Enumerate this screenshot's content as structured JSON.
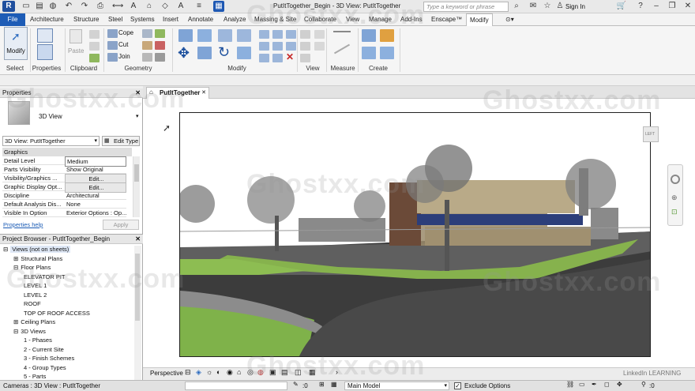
{
  "titlebar": {
    "doc_title": "PutItTogether_Begin - 3D View: PutItTogether",
    "search_placeholder": "Type a keyword or phrase",
    "sign_in": "Sign In"
  },
  "tabs": [
    "File",
    "Architecture",
    "Structure",
    "Steel",
    "Systems",
    "Insert",
    "Annotate",
    "Analyze",
    "Massing & Site",
    "Collaborate",
    "View",
    "Manage",
    "Add-Ins",
    "Enscape™",
    "Modify"
  ],
  "active_tab": "Modify",
  "ribbon": {
    "select": {
      "modify_label": "Modify",
      "group": "Select"
    },
    "properties_group": "Properties",
    "clipboard": {
      "paste": "Paste",
      "group": "Clipboard"
    },
    "geometry": {
      "cope": "Cope",
      "cut": "Cut",
      "join": "Join",
      "group": "Geometry"
    },
    "modify_group": "Modify",
    "view_group": "View",
    "measure_group": "Measure",
    "create_group": "Create"
  },
  "properties": {
    "title": "Properties",
    "type_name": "3D View",
    "selector": "3D View: PutItTogether",
    "edit_type": "Edit Type",
    "section": "Graphics",
    "rows": [
      {
        "k": "Detail Level",
        "v": "Medium"
      },
      {
        "k": "Parts Visibility",
        "v": "Show Original"
      },
      {
        "k": "Visibility/Graphics ...",
        "v": "Edit..."
      },
      {
        "k": "Graphic Display Opt...",
        "v": "Edit..."
      },
      {
        "k": "Discipline",
        "v": "Architectural"
      },
      {
        "k": "Default Analysis Dis...",
        "v": "None"
      },
      {
        "k": "Visible In Option",
        "v": "Exterior Options : Op..."
      }
    ],
    "help_link": "Properties help",
    "apply": "Apply"
  },
  "browser": {
    "title": "Project Browser - PutItTogether_Begin",
    "items": [
      {
        "label": "Views (not on sheets)",
        "level": 0,
        "sign": "⊟"
      },
      {
        "label": "Structural Plans",
        "level": 1,
        "sign": "⊞"
      },
      {
        "label": "Floor Plans",
        "level": 1,
        "sign": "⊟"
      },
      {
        "label": "ELEVATOR PIT",
        "level": 2,
        "sign": ""
      },
      {
        "label": "LEVEL 1",
        "level": 2,
        "sign": ""
      },
      {
        "label": "LEVEL 2",
        "level": 2,
        "sign": ""
      },
      {
        "label": "ROOF",
        "level": 2,
        "sign": ""
      },
      {
        "label": "TOP OF ROOF ACCESS",
        "level": 2,
        "sign": ""
      },
      {
        "label": "Ceiling Plans",
        "level": 1,
        "sign": "⊞"
      },
      {
        "label": "3D Views",
        "level": 1,
        "sign": "⊟"
      },
      {
        "label": "1 - Phases",
        "level": 2,
        "sign": ""
      },
      {
        "label": "2 - Current Site",
        "level": 2,
        "sign": ""
      },
      {
        "label": "3 - Finish Schemes",
        "level": 2,
        "sign": ""
      },
      {
        "label": "4 - Group Types",
        "level": 2,
        "sign": ""
      },
      {
        "label": "5 - Parts",
        "level": 2,
        "sign": ""
      }
    ]
  },
  "view_tab": "PutItTogether",
  "viewcube_label": "LEFT",
  "viewbar": {
    "mode": "Perspective"
  },
  "status": {
    "left": "Cameras : 3D View : PutItTogether",
    "coord": ":0",
    "model": "Main Model",
    "exclude": "Exclude Options",
    "filter": ":0"
  },
  "watermark": {
    "text": "Ghostxx.com",
    "brand": "LinkedIn LEARNING"
  }
}
